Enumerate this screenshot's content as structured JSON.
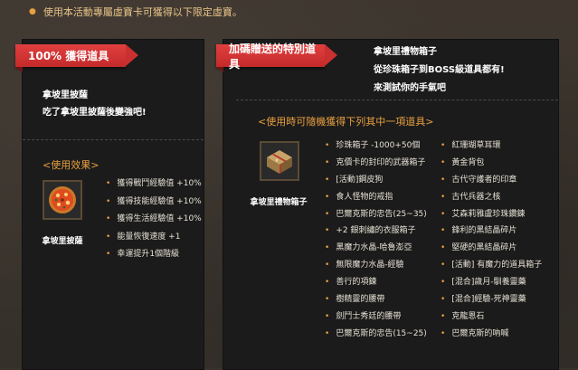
{
  "notice": {
    "text": "使用本活動專屬虛寶卡可獲得以下限定虛寶。"
  },
  "left_panel": {
    "ribbon": "100% 獲得道具",
    "item_name": "拿坡里披薩",
    "item_desc": "吃了拿坡里披薩後變強吧!",
    "effect_label": "<使用效果>",
    "icon_caption": "拿坡里披薩",
    "effects": [
      "獲得戰鬥經驗值 +10%",
      "獲得技能經驗值 +10%",
      "獲得生活經驗值 +10%",
      "能量恢復速度 +1",
      "幸運提升1個階級"
    ]
  },
  "right_panel": {
    "ribbon": "加碼贈送的特別道具",
    "box_name": "拿坡里禮物箱子",
    "box_line1": "從珍珠箱子到BOSS級道具都有!",
    "box_line2": "來測試你的手氣吧",
    "random_label": "<使用時可隨機獲得下列其中一項道具>",
    "icon_caption": "拿坡里禮物箱子",
    "rewards_col1": [
      "珍珠箱子 -1000+50個",
      "克價卡的封印的武器箱子",
      "[活動]鋼皮狗",
      "食人怪物的戒指",
      "巴爾克斯的忠告(25~35)",
      "+2 銀刺繡的衣服箱子",
      "黑魔力水晶-哈魯澎亞",
      "無限魔力水晶-經驗",
      "善行的項鍊",
      "樹精靈的腰帶",
      "劍鬥士秀廷的腰帶",
      "巴爾克斯的忠告(15~25)"
    ],
    "rewards_col2": [
      "紅珊瑚草耳環",
      "黃金背包",
      "古代守護者的印章",
      "古代兵器之核",
      "艾森莉雅盧珍珠鑽鍊",
      "鋒利的黑結晶碎片",
      "堅硬的黑結晶碎片",
      "[活動] 有魔力的道具箱子",
      "[混合]歲月-馴養靈藥",
      "[混合]經驗-死神靈藥",
      "克龍恩石",
      "巴爾克斯的吶喊"
    ]
  },
  "colors": {
    "accent": "#e8a040",
    "ribbon": "#d33a39",
    "panel": "#1b1b1b"
  },
  "icons": {
    "pizza": "pizza-icon",
    "gift_box": "gift-box-icon"
  }
}
